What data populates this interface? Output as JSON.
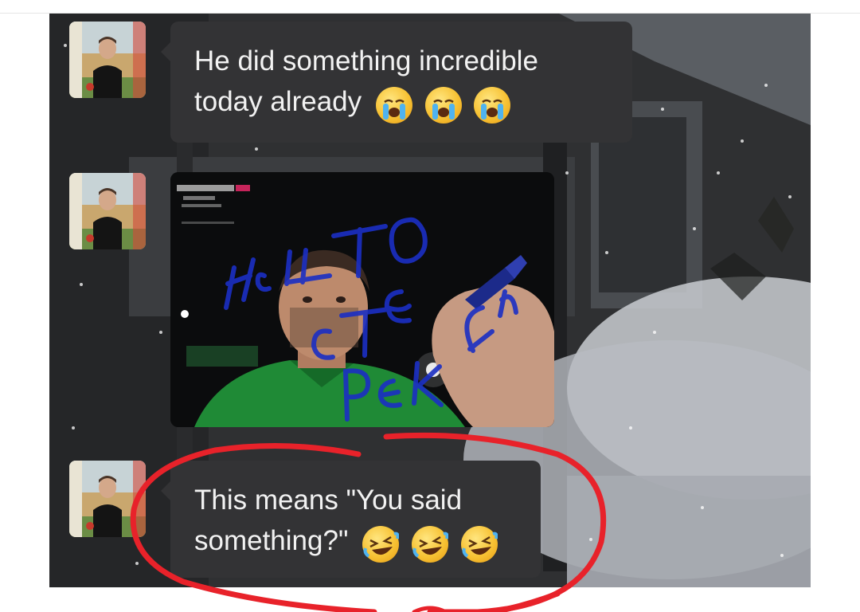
{
  "messages": [
    {
      "type": "text",
      "text": "He did something incredible today already",
      "emoji": [
        "loudly-crying-face",
        "loudly-crying-face",
        "loudly-crying-face"
      ]
    },
    {
      "type": "image",
      "overlay_handwriting": "НЕШТО СТЕ РЕКЛИ"
    },
    {
      "type": "text",
      "text": "This means \"You said something?\"",
      "emoji": [
        "rolling-on-floor-laughing",
        "rolling-on-floor-laughing",
        "rolling-on-floor-laughing"
      ]
    }
  ],
  "colors": {
    "bubble": "#333335",
    "bubble_text": "#f2f2f2",
    "annotation_circle": "#e8222a",
    "handwriting": "#1b2fc4"
  }
}
